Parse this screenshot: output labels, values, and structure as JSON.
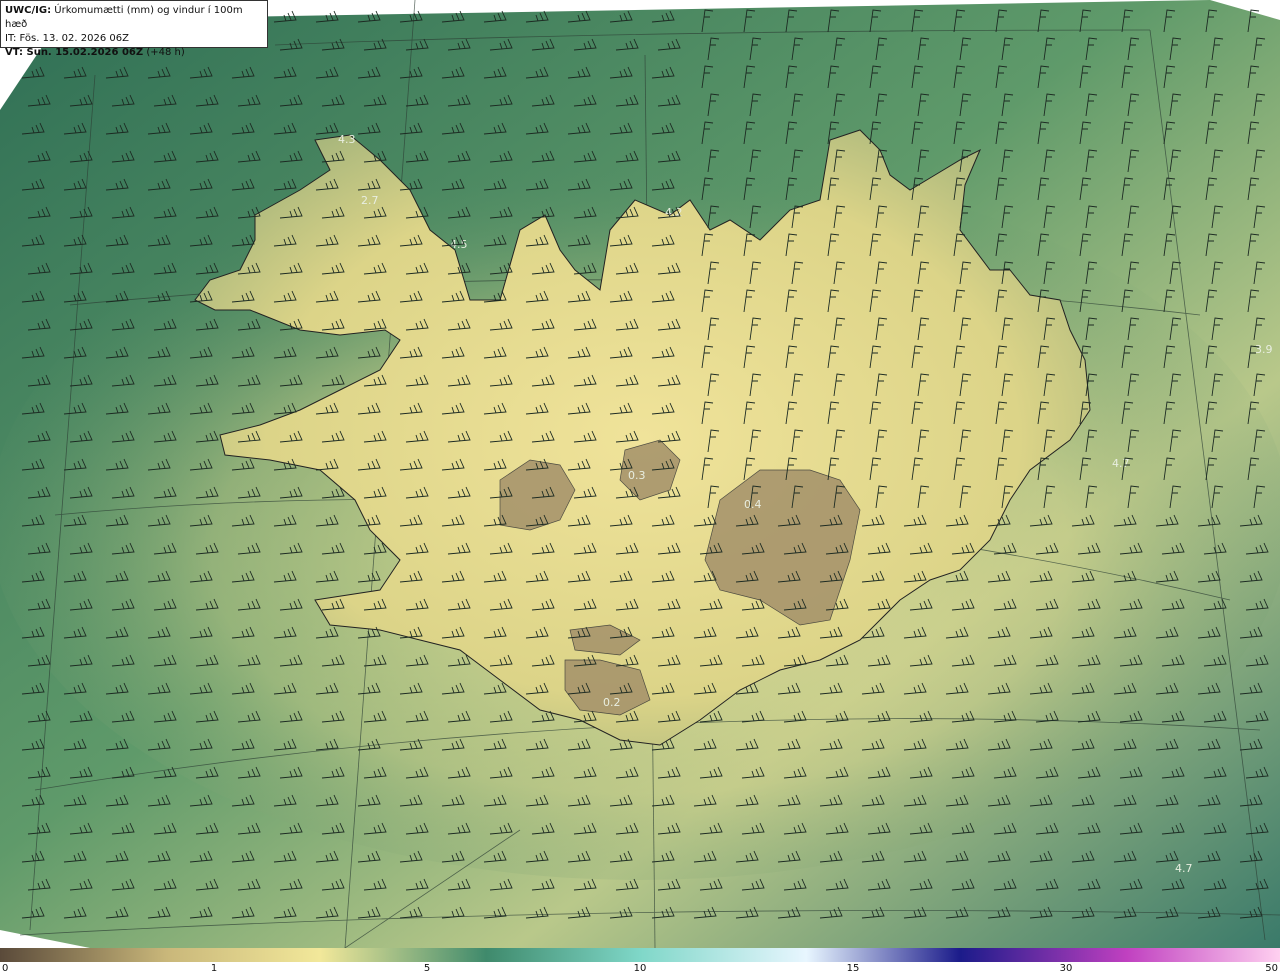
{
  "header": {
    "model": "UWC/IG:",
    "product": "Úrkomumætti (mm) og vindur í 100m hæð",
    "init_time": "IT: Fös. 13. 02. 2026 06Z",
    "valid_prefix": "VT: Sun. 15.02.2026 06Z",
    "lead": "(+48 h)"
  },
  "map_labels": [
    "4.3",
    "2.7",
    "4.5",
    "4.2",
    "3.9",
    "4.7",
    "0.3",
    "0.4",
    "0.2",
    "4.7"
  ],
  "colorbar": {
    "ticks": [
      "0",
      "1",
      "5",
      "10",
      "15",
      "30",
      "50"
    ],
    "colors": [
      "#5a4a3a",
      "#c9b77a",
      "#f2e89a",
      "#3f8a6c",
      "#7fd7c8",
      "#e8f6ff",
      "#1b1b8a",
      "#c040c0",
      "#ffd0f0"
    ]
  },
  "colors": {
    "sea": "#3f7d5a",
    "land_low": "#e8df8f",
    "land_mid": "#c9b77a",
    "land_high": "#8c7c5c"
  }
}
